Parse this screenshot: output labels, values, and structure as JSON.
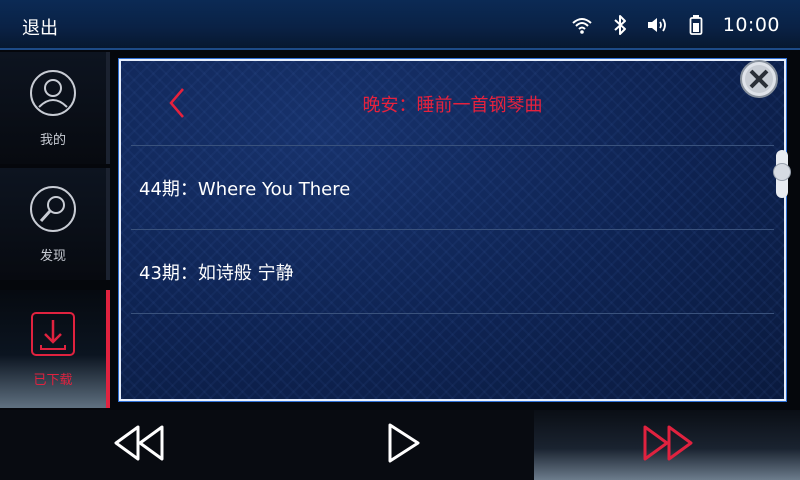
{
  "header": {
    "exit_label": "退出",
    "time": "10:00",
    "icons": [
      "wifi-icon",
      "bluetooth-icon",
      "volume-icon",
      "battery-icon"
    ]
  },
  "sidebar": {
    "items": [
      {
        "label": "我的",
        "icon": "person-icon",
        "active": false
      },
      {
        "label": "发现",
        "icon": "magnifier-icon",
        "active": false
      },
      {
        "label": "已下载",
        "icon": "download-icon",
        "active": true
      }
    ]
  },
  "panel": {
    "title": "晚安：睡前一首钢琴曲",
    "items": [
      {
        "label": "44期：Where You There"
      },
      {
        "label": "43期：如诗般 宁静"
      }
    ]
  },
  "controls": {
    "buttons": [
      "previous-icon",
      "play-icon",
      "next-icon"
    ]
  },
  "colors": {
    "accent": "#e0223f",
    "panel_bg": "#0e2352",
    "header_bg": "#0a2246"
  }
}
